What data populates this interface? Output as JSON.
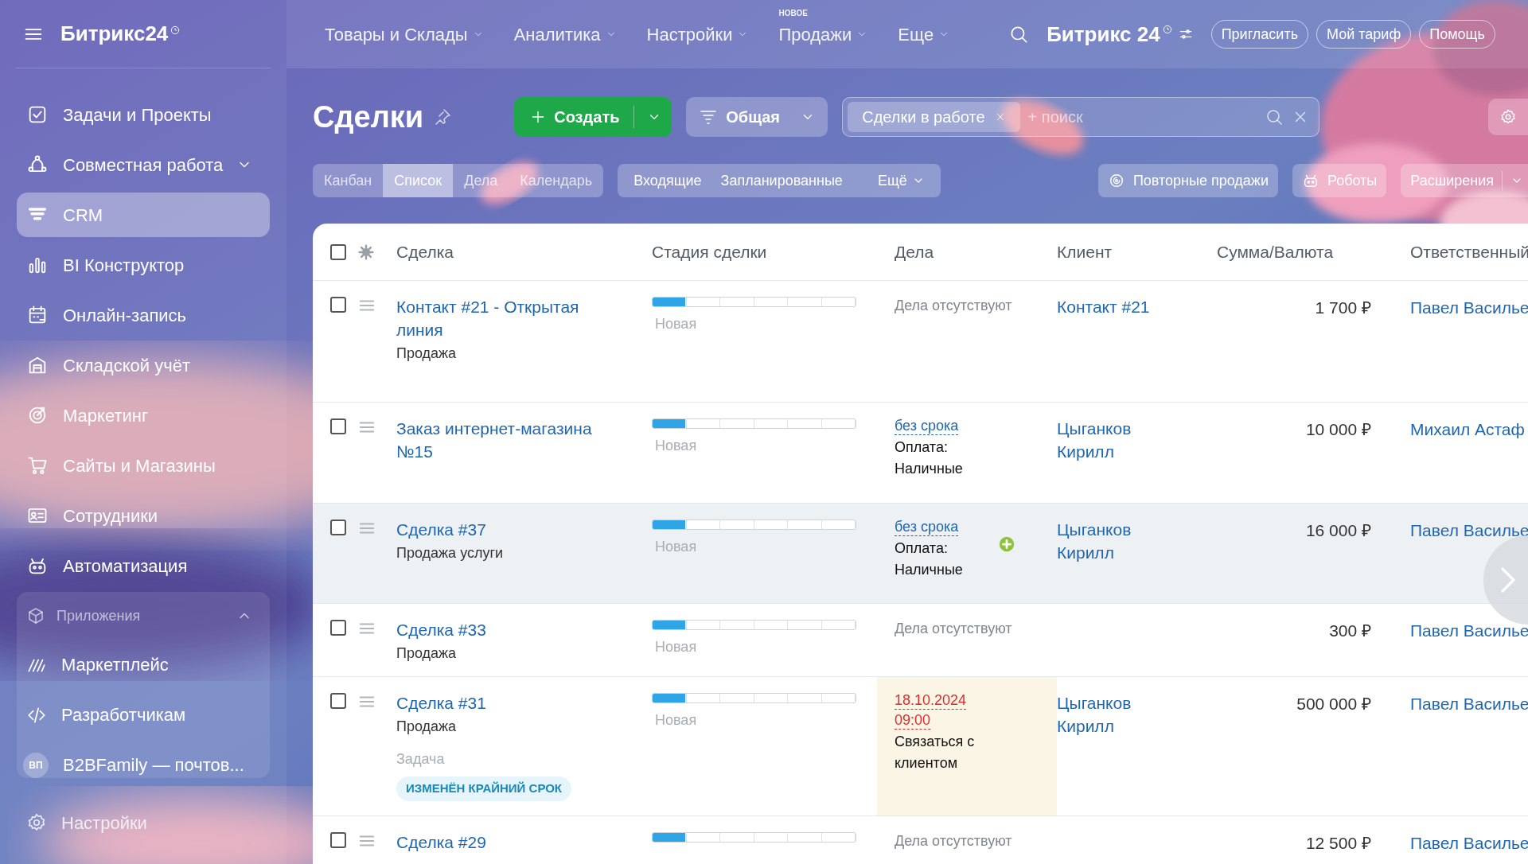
{
  "sidebar": {
    "logo": "Битрикс24",
    "items": [
      {
        "label": "Задачи и Проекты",
        "selected": false,
        "expandable": false
      },
      {
        "label": "Совместная работа",
        "selected": false,
        "expandable": true
      },
      {
        "label": "CRM",
        "selected": true,
        "expandable": false
      },
      {
        "label": "BI Конструктор",
        "selected": false,
        "expandable": false
      },
      {
        "label": "Онлайн-запись",
        "selected": false,
        "expandable": false
      },
      {
        "label": "Складской учёт",
        "selected": false,
        "expandable": false
      },
      {
        "label": "Маркетинг",
        "selected": false,
        "expandable": false
      },
      {
        "label": "Сайты и Магазины",
        "selected": false,
        "expandable": false
      },
      {
        "label": "Сотрудники",
        "selected": false,
        "expandable": false
      },
      {
        "label": "Автоматизация",
        "selected": false,
        "expandable": false
      }
    ],
    "apps_group": {
      "label": "Приложения",
      "expanded": true,
      "items": [
        {
          "label": "Маркетплейс"
        },
        {
          "label": "Разработчикам"
        },
        {
          "label": "B2BFamily — почтов...",
          "avatar": "ВП"
        }
      ]
    },
    "settings": "Настройки"
  },
  "top_nav": {
    "items": [
      {
        "label": "Товары и Склады"
      },
      {
        "label": "Аналитика"
      },
      {
        "label": "Настройки"
      },
      {
        "label": "Продажи",
        "badge": "НОВОЕ"
      },
      {
        "label": "Еще"
      }
    ],
    "logo": "Битрикс 24",
    "buttons": [
      "Пригласить",
      "Мой тариф",
      "Помощь"
    ]
  },
  "toolbar": {
    "title": "Сделки",
    "create_button": "Создать",
    "filter_preset": "Общая",
    "search": {
      "tags": [
        "Сделки в работе"
      ],
      "placeholder": "+ поиск"
    }
  },
  "view_tabs": [
    {
      "label": "Канбан",
      "selected": false
    },
    {
      "label": "Список",
      "selected": true
    },
    {
      "label": "Дела",
      "selected": false
    },
    {
      "label": "Календарь",
      "selected": false
    }
  ],
  "counters": {
    "items": [
      "Входящие",
      "Запланированные"
    ],
    "more": "Ещё"
  },
  "actions": [
    "Повторные продажи",
    "Роботы",
    "Расширения"
  ],
  "table": {
    "all_checked": false,
    "columns": [
      "Сделка",
      "Стадия сделки",
      "Дела",
      "Клиент",
      "Сумма/Валюта",
      "Ответственный"
    ],
    "rows": [
      {
        "checked": false,
        "hovered": false,
        "quick_add": false,
        "title": "Контакт #21 - Открытая линия",
        "subtitle": "Продажа",
        "stage": "Новая",
        "level": 0.16,
        "tasks": {
          "kind": "none",
          "text": "Дела отсутствуют"
        },
        "client": "Контакт #21",
        "sum": "1 700 ₽",
        "responsible": "Павел Василье"
      },
      {
        "checked": false,
        "hovered": false,
        "quick_add": false,
        "title": "Заказ интернет-магазина №15",
        "stage": "Новая",
        "level": 0.16,
        "tasks": {
          "kind": "payment",
          "deadline": "без срока",
          "text": "Оплата: Наличные"
        },
        "client": "Цыганков Кирилл",
        "sum": "10 000 ₽",
        "responsible": "Михаил Астаф"
      },
      {
        "checked": false,
        "hovered": true,
        "quick_add": true,
        "title": "Сделка #37",
        "subtitle": "Продажа услуги",
        "stage": "Новая",
        "level": 0.16,
        "tasks": {
          "kind": "payment",
          "deadline": "без срока",
          "text": "Оплата: Наличные"
        },
        "client": "Цыганков Кирилл",
        "sum": "16 000 ₽",
        "responsible": "Павел Василье"
      },
      {
        "checked": false,
        "hovered": false,
        "quick_add": false,
        "title": "Сделка #33",
        "subtitle": "Продажа",
        "stage": "Новая",
        "level": 0.16,
        "tasks": {
          "kind": "none",
          "text": "Дела отсутствуют"
        },
        "sum": "300 ₽",
        "responsible": "Павел Василье"
      },
      {
        "checked": false,
        "hovered": false,
        "quick_add": false,
        "title": "Сделка #31",
        "subtitle": "Продажа",
        "activity": {
          "label": "Задача",
          "badge": "ИЗМЕНЁН КРАЙНИЙ СРОК"
        },
        "stage": "Новая",
        "level": 0.16,
        "tasks": {
          "kind": "overdue",
          "date": "18.10.2024",
          "time": "09:00",
          "text": "Связаться с клиентом"
        },
        "client": "Цыганков Кирилл",
        "sum": "500 000 ₽",
        "responsible": "Павел Василье"
      },
      {
        "checked": false,
        "hovered": false,
        "quick_add": false,
        "title": "Сделка #29",
        "level": 0.16,
        "tasks": {
          "kind": "none",
          "text": "Дела отсутствуют"
        },
        "sum": "12 500 ₽",
        "responsible": "Павел Василье"
      }
    ]
  }
}
